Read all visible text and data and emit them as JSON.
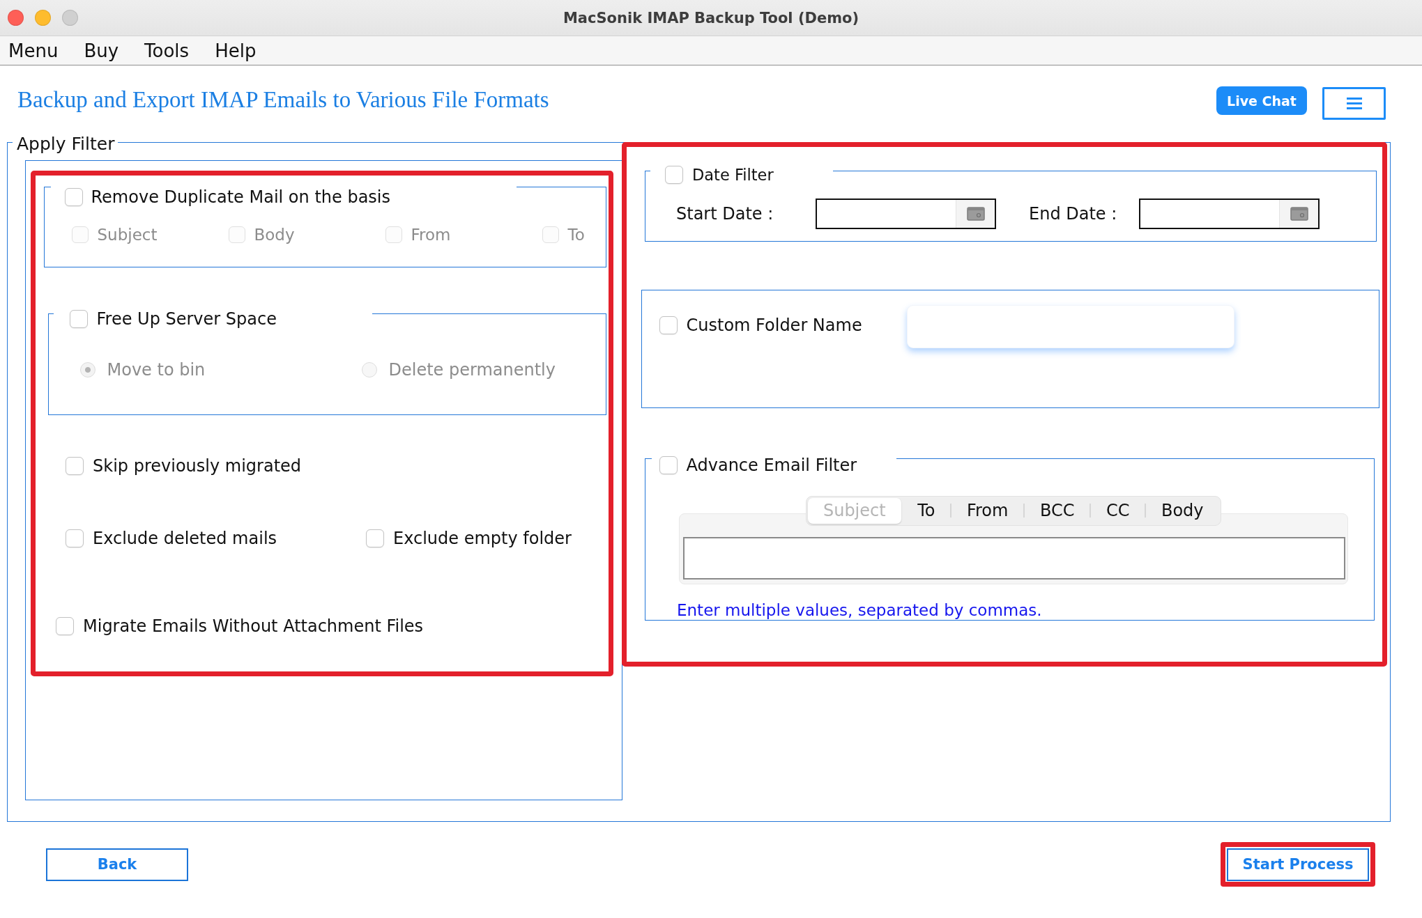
{
  "window": {
    "title": "MacSonik IMAP Backup Tool (Demo)",
    "controls": [
      {
        "kind": "close",
        "disabled": false
      },
      {
        "kind": "minimize",
        "disabled": false
      },
      {
        "kind": "zoom",
        "disabled": true
      }
    ]
  },
  "menu_bar": [
    "Menu",
    "Buy",
    "Tools",
    "Help"
  ],
  "header": {
    "title": "Backup and Export IMAP Emails to Various File Formats",
    "live_chat": "Live Chat"
  },
  "apply_filter": {
    "title": "Apply Filter",
    "left_panel": {
      "highlighted": true,
      "remove_duplicate": {
        "label": "Remove Duplicate Mail on the basis",
        "checked": false,
        "options": [
          {
            "label": "Subject",
            "checked": false,
            "disabled": true
          },
          {
            "label": "Body",
            "checked": false,
            "disabled": true
          },
          {
            "label": "From",
            "checked": false,
            "disabled": true
          },
          {
            "label": "To",
            "checked": false,
            "disabled": true
          }
        ]
      },
      "free_up_server_space": {
        "label": "Free Up Server Space",
        "checked": false,
        "options": [
          {
            "label": "Move to bin",
            "selected": true,
            "disabled": true
          },
          {
            "label": "Delete permanently",
            "selected": false,
            "disabled": true
          }
        ]
      },
      "skip_previously_migrated": {
        "label": "Skip previously migrated",
        "checked": false
      },
      "exclude_options": [
        {
          "label": "Exclude deleted mails",
          "checked": false
        },
        {
          "label": "Exclude empty folder",
          "checked": false
        }
      ],
      "migrate_without_attachments": {
        "label": "Migrate Emails Without Attachment Files",
        "checked": false
      }
    },
    "right_panel": {
      "highlighted": true,
      "date_filter": {
        "label": "Date Filter",
        "checked": false,
        "start_date_label": "Start Date :",
        "end_date_label": "End Date :"
      },
      "custom_folder_name": {
        "label": "Custom Folder Name",
        "checked": false
      },
      "advance_email_filter": {
        "label": "Advance Email Filter",
        "checked": false,
        "tabs": [
          {
            "label": "Subject",
            "selected": true
          },
          {
            "label": "To",
            "selected": false
          },
          {
            "label": "From",
            "selected": false
          },
          {
            "label": "BCC",
            "selected": false
          },
          {
            "label": "CC",
            "selected": false
          },
          {
            "label": "Body",
            "selected": false
          }
        ],
        "hint": "Enter multiple values, separated by commas."
      }
    }
  },
  "footer": {
    "buttons": [
      {
        "label": "Back",
        "highlighted": false
      },
      {
        "label": "Start Process",
        "highlighted": true
      }
    ]
  }
}
